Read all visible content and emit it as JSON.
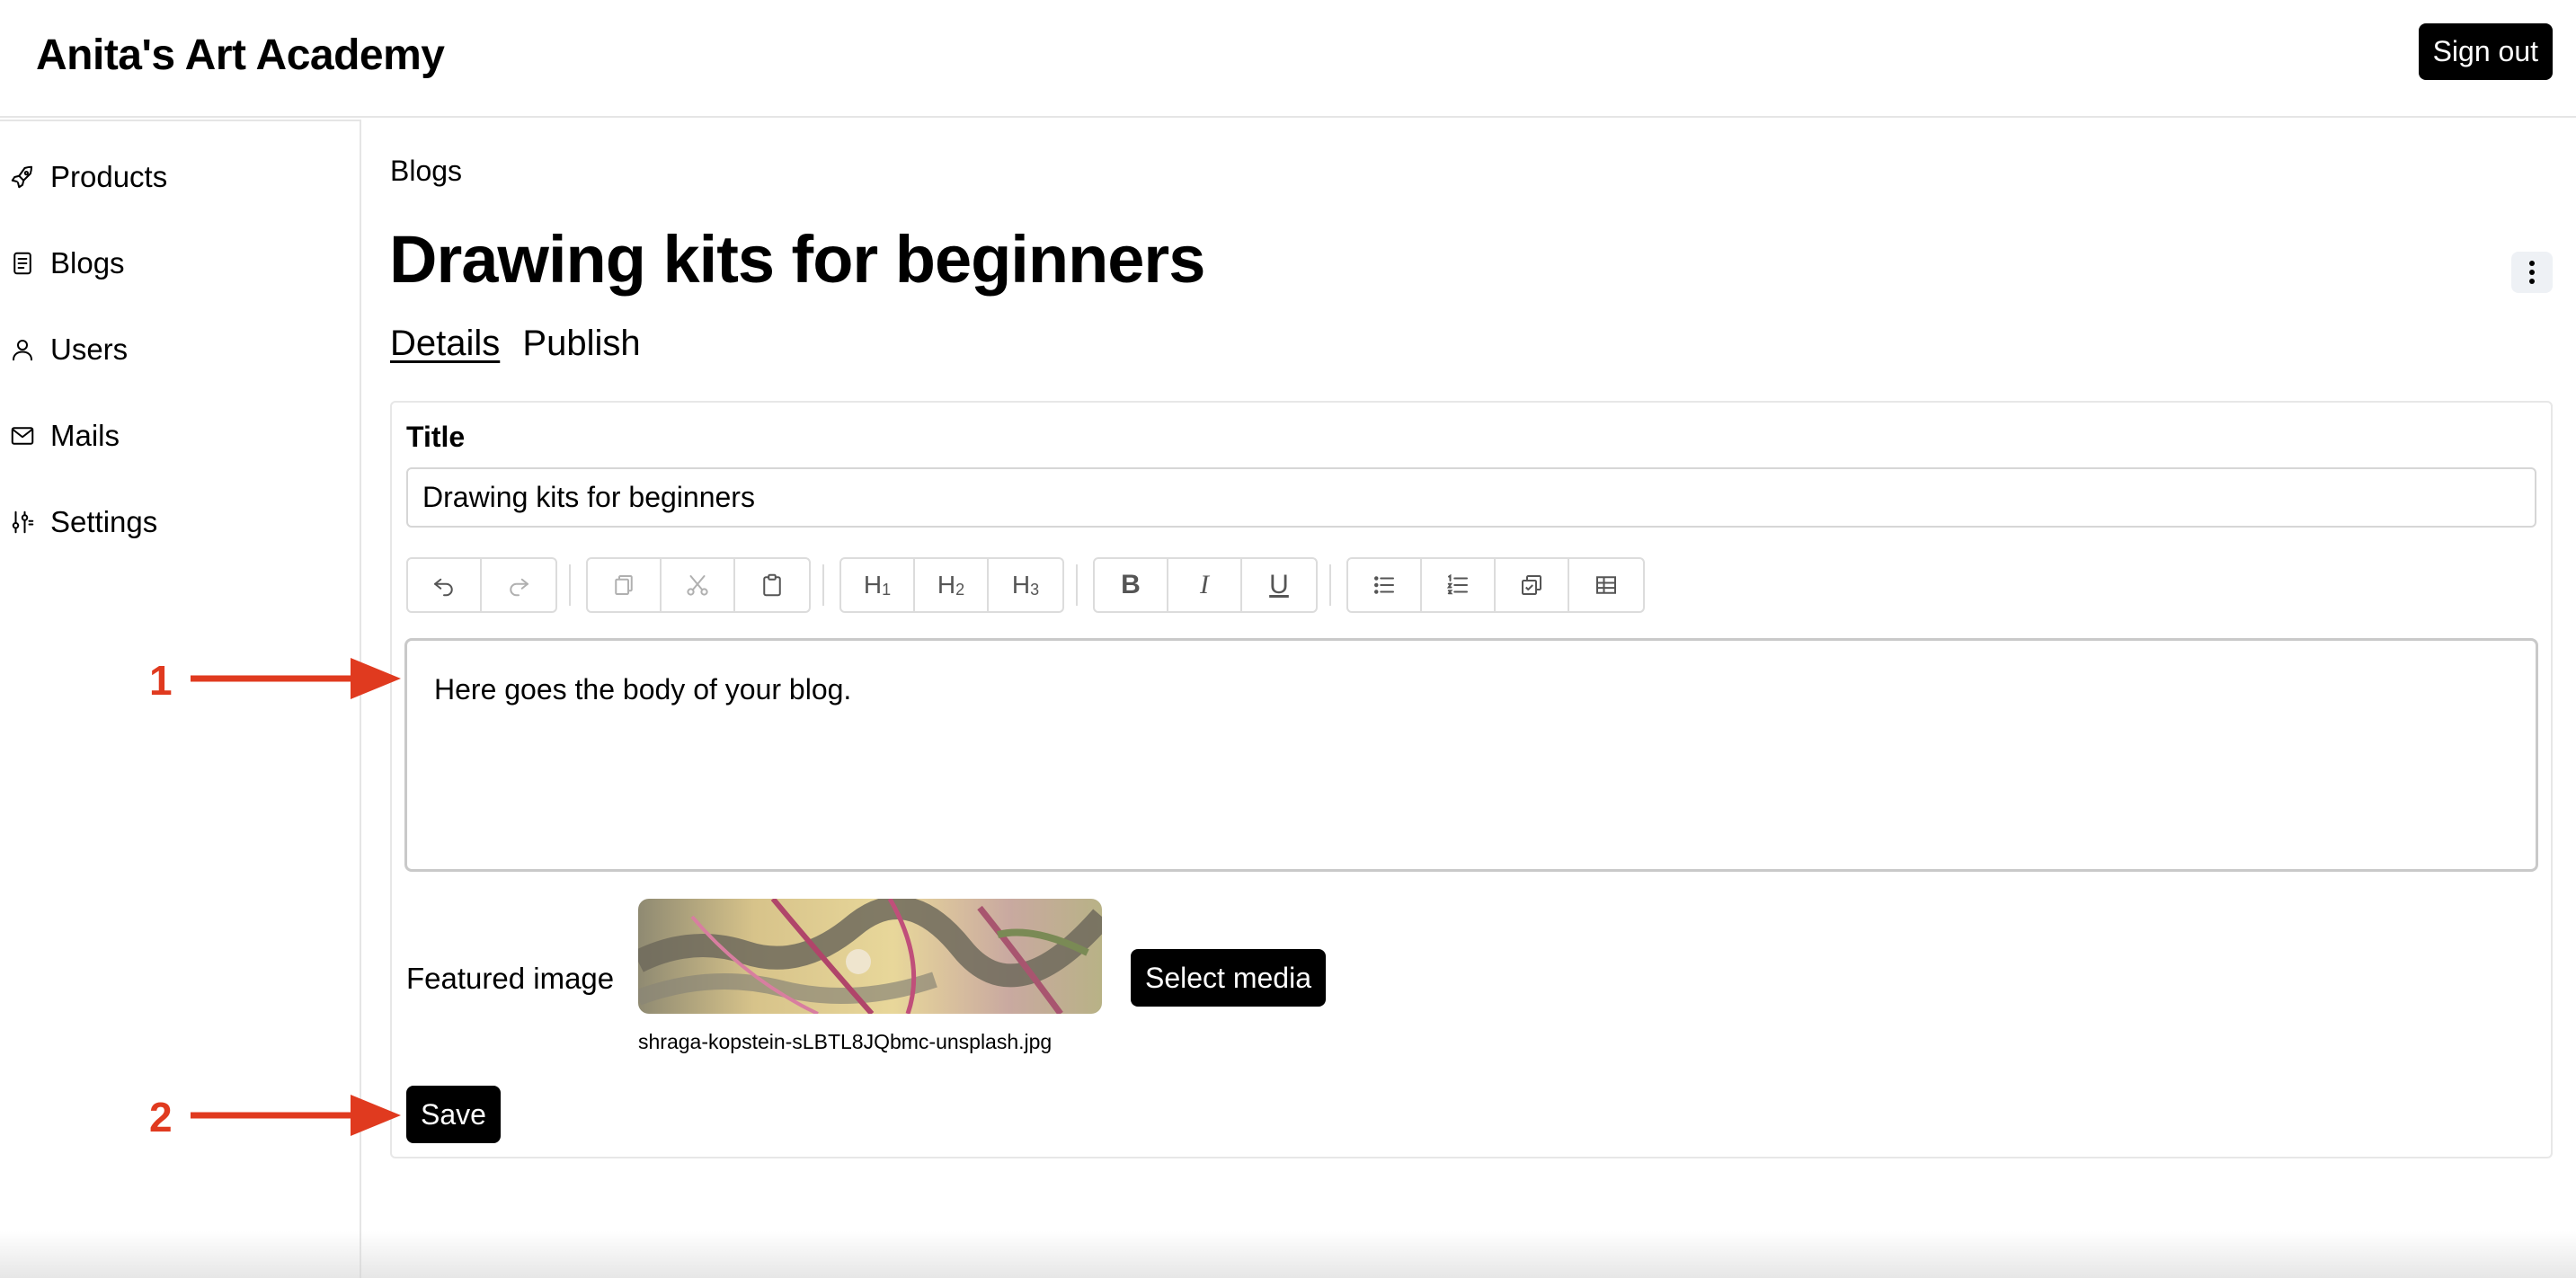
{
  "header": {
    "app_title": "Anita's Art Academy",
    "sign_out_label": "Sign out"
  },
  "sidebar": {
    "items": [
      {
        "label": "Products",
        "icon": "rocket-icon"
      },
      {
        "label": "Blogs",
        "icon": "document-icon"
      },
      {
        "label": "Users",
        "icon": "user-icon"
      },
      {
        "label": "Mails",
        "icon": "mail-icon"
      },
      {
        "label": "Settings",
        "icon": "sliders-icon"
      }
    ]
  },
  "main": {
    "breadcrumb": "Blogs",
    "page_title": "Drawing kits for beginners",
    "tabs": [
      {
        "label": "Details",
        "active": true
      },
      {
        "label": "Publish",
        "active": false
      }
    ],
    "form": {
      "title_label": "Title",
      "title_value": "Drawing kits for beginners",
      "toolbar": {
        "heading_labels": [
          "H1",
          "H2",
          "H3"
        ],
        "format_labels": [
          "B",
          "I",
          "U"
        ]
      },
      "body_text": "Here goes the body of your blog.",
      "featured_image_label": "Featured image",
      "featured_image_filename": "shraga-kopstein-sLBTL8JQbmc-unsplash.jpg",
      "select_media_label": "Select media",
      "save_label": "Save"
    }
  },
  "annotations": [
    {
      "number": "1"
    },
    {
      "number": "2"
    }
  ],
  "colors": {
    "accent": "#000000",
    "annotation": "#e03a1f",
    "border": "#e5e5e5"
  }
}
